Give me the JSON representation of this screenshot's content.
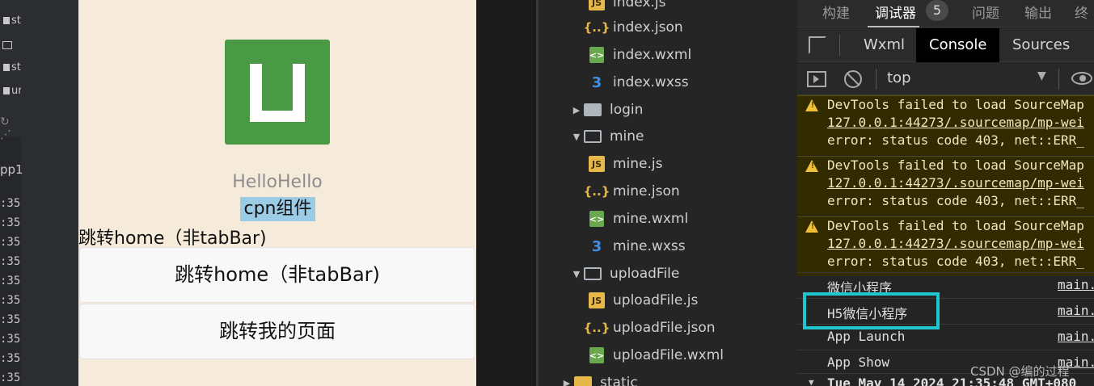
{
  "left_strip": {
    "tree_labels": [
      "st",
      "",
      "st",
      "ur",
      "u"
    ],
    "app_label": "pp1",
    "time_prefixes": [
      ":35",
      ":35",
      ":35",
      ":35",
      ":35",
      ":35",
      ":35",
      ":35",
      ":35",
      ":35"
    ]
  },
  "simulator": {
    "hello_text": "HelloHello",
    "cpn_text": "cpn组件",
    "nav_text": "跳转home（非tabBar)",
    "button1_label": "跳转home（非tabBar)",
    "button2_label": "跳转我的页面",
    "logo_color": "#4a9945"
  },
  "file_tree": {
    "items": [
      {
        "label": "index.js",
        "type": "js"
      },
      {
        "label": "index.json",
        "type": "json"
      },
      {
        "label": "index.wxml",
        "type": "wxml"
      },
      {
        "label": "index.wxss",
        "type": "wxss"
      },
      {
        "label": "login",
        "type": "folder",
        "expanded": false
      },
      {
        "label": "mine",
        "type": "folder",
        "expanded": true
      },
      {
        "label": "mine.js",
        "type": "js"
      },
      {
        "label": "mine.json",
        "type": "json"
      },
      {
        "label": "mine.wxml",
        "type": "wxml"
      },
      {
        "label": "mine.wxss",
        "type": "wxss"
      },
      {
        "label": "uploadFile",
        "type": "folder",
        "expanded": true
      },
      {
        "label": "uploadFile.js",
        "type": "js"
      },
      {
        "label": "uploadFile.json",
        "type": "json"
      },
      {
        "label": "uploadFile.wxml",
        "type": "wxml"
      },
      {
        "label": "static",
        "type": "folder",
        "expanded": false
      }
    ],
    "icon_text": {
      "js": "JS",
      "json": "{..}",
      "wxml": "<>",
      "wxss": "3"
    }
  },
  "devtools": {
    "top_tabs": [
      "构建",
      "调试器",
      "问题",
      "输出",
      "终"
    ],
    "active_top_tab": "调试器",
    "issue_count": "5",
    "panel_tabs": [
      "Wxml",
      "Console",
      "Sources"
    ],
    "active_panel_tab": "Console",
    "context_select": "top",
    "warnings": [
      {
        "line1": "DevTools failed to load SourceMap",
        "line2": "127.0.0.1:44273/.sourcemap/mp-wei",
        "line3": "error: status code 403, net::ERR_"
      },
      {
        "line1": "DevTools failed to load SourceMap",
        "line2": "127.0.0.1:44273/.sourcemap/mp-wei",
        "line3": "error: status code 403, net::ERR_"
      },
      {
        "line1": "DevTools failed to load SourceMap",
        "line2": "127.0.0.1:44273/.sourcemap/mp-wei",
        "line3": "error: status code 403, net::ERR_"
      }
    ],
    "logs": [
      {
        "message": "微信小程序",
        "source": "main."
      },
      {
        "message": "H5微信小程序",
        "source": "main."
      },
      {
        "message": "App Launch",
        "source": "main."
      },
      {
        "message": "App Show",
        "source": "main."
      }
    ],
    "group_header": "Tue May 14 2024 21:35:48 GMT+080"
  },
  "watermark": "CSDN @编的过程",
  "colors": {
    "highlight": "#1ec6cf",
    "warning_bg": "#332b00",
    "simulator_bg": "#f6ebda"
  }
}
